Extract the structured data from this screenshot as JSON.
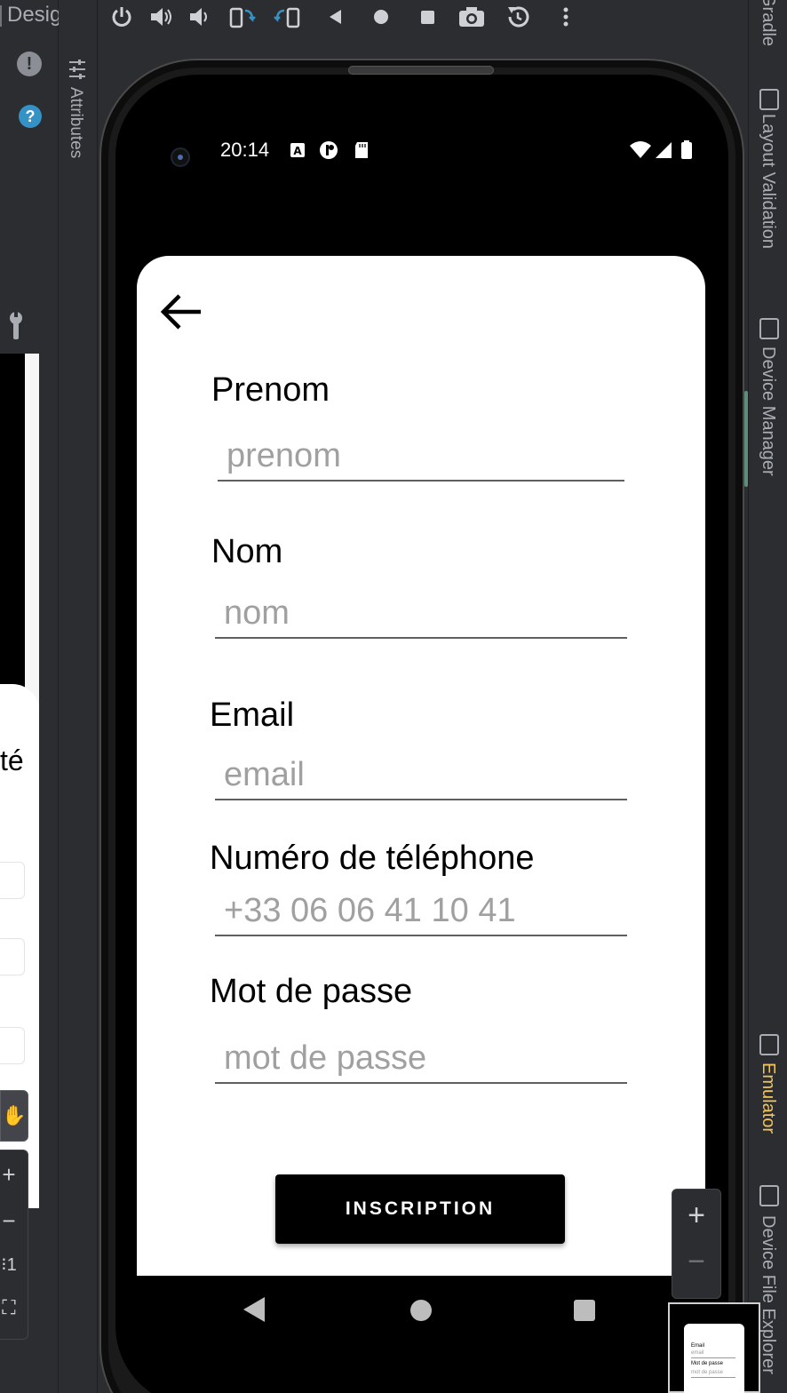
{
  "ide": {
    "left_tab_label": "Design",
    "attributes_label": "Attributes",
    "right_tabs": {
      "gradle": "Gradle",
      "layout_validation": "Layout Validation",
      "device_manager": "Device Manager",
      "emulator": "Emulator",
      "device_file_explorer": "Device File Explorer"
    },
    "left_preview_text": "té",
    "toolbar_icons": [
      "power-icon",
      "volume-up-icon",
      "volume-down-icon",
      "rotate-left-icon",
      "rotate-right-icon",
      "back-icon",
      "home-icon",
      "overview-icon",
      "screenshot-icon",
      "snapshot-icon",
      "more-icon"
    ],
    "zoom_plus": "+",
    "zoom_minus": "−",
    "accent_color": "#f2c55c"
  },
  "status_bar": {
    "time": "20:14"
  },
  "form": {
    "fields": [
      {
        "label": "Prenom",
        "placeholder": "prenom"
      },
      {
        "label": "Nom",
        "placeholder": "nom"
      },
      {
        "label": "Email",
        "placeholder": "email"
      },
      {
        "label": "Numéro de téléphone",
        "placeholder": "+33 06 06 41 10 41"
      },
      {
        "label": "Mot de passe",
        "placeholder": "mot de passe"
      }
    ],
    "submit_label": "INSCRIPTION"
  },
  "minimap": {
    "email_label": "Email",
    "email_placeholder": "email",
    "password_label": "Mot de passe",
    "password_placeholder": "mot de passe"
  }
}
